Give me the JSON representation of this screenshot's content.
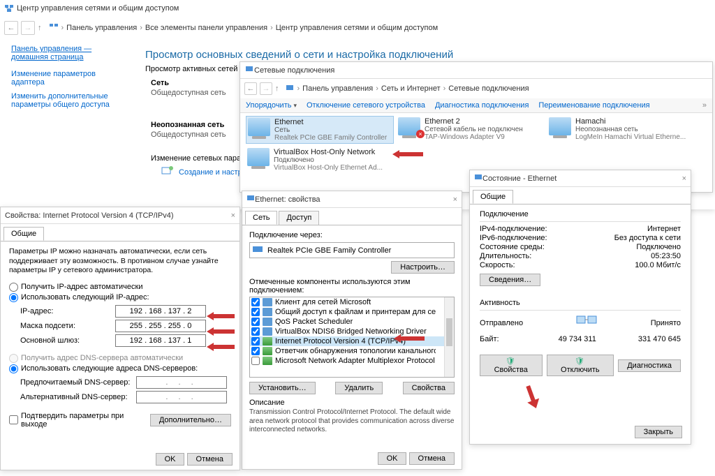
{
  "main": {
    "title": "Центр управления сетями и общим доступом",
    "breadcrumb": [
      "Панель управления",
      "Все элементы панели управления",
      "Центр управления сетями и общим доступом"
    ],
    "heading": "Просмотр основных сведений о сети и настройка подключений",
    "activeNetworks": "Просмотр активных сетей",
    "sidebar": {
      "home": "Панель управления — домашняя страница",
      "adapter": "Изменение параметров адаптера",
      "sharing": "Изменить дополнительные параметры общего доступа"
    },
    "net1": {
      "name": "Сеть",
      "type": "Общедоступная сеть"
    },
    "net2": {
      "name": "Неопознанная сеть",
      "type": "Общедоступная сеть"
    },
    "changeSettings": "Изменение сетевых параметров",
    "newConn": "Создание и настройка"
  },
  "netconn": {
    "title": "Сетевые подключения",
    "breadcrumb": [
      "Панель управления",
      "Сеть и Интернет",
      "Сетевые подключения"
    ],
    "toolbar": {
      "organize": "Упорядочить",
      "disable": "Отключение сетевого устройства",
      "diag": "Диагностика подключения",
      "rename": "Переименование подключения"
    },
    "conns": [
      {
        "name": "Ethernet",
        "l2": "Сеть",
        "l3": "Realtek PCIe GBE Family Controller"
      },
      {
        "name": "Ethernet 2",
        "l2": "Сетевой кабель не подключен",
        "l3": "TAP-Windows Adapter V9"
      },
      {
        "name": "Hamachi",
        "l2": "Неопознанная сеть",
        "l3": "LogMeIn Hamachi Virtual Etherne..."
      },
      {
        "name": "VirtualBox Host-Only Network",
        "l2": "Подключено",
        "l3": "VirtualBox Host-Only Ethernet Ad..."
      }
    ]
  },
  "ethprops": {
    "title": "Ethernet: свойства",
    "tabs": {
      "net": "Сеть",
      "access": "Доступ"
    },
    "connectVia": "Подключение через:",
    "adapter": "Realtek PCIe GBE Family Controller",
    "configure": "Настроить…",
    "componentsHeading": "Отмеченные компоненты используются этим подключением:",
    "components": [
      "Клиент для сетей Microsoft",
      "Общий доступ к файлам и принтерам для сетей Microsoft",
      "QoS Packet Scheduler",
      "VirtualBox NDIS6 Bridged Networking Driver",
      "Internet Protocol Version 4 (TCP/IPv4)",
      "Ответчик обнаружения топологии канального уровня",
      "Microsoft Network Adapter Multiplexor Protocol"
    ],
    "install": "Установить…",
    "remove": "Удалить",
    "props": "Свойства",
    "descHeading": "Описание",
    "desc": "Transmission Control Protocol/Internet Protocol. The default wide area network protocol that provides communication across diverse interconnected networks.",
    "ok": "OK",
    "cancel": "Отмена"
  },
  "status": {
    "title": "Состояние - Ethernet",
    "tab": "Общие",
    "connHeading": "Подключение",
    "rows": {
      "ipv4": {
        "k": "IPv4-подключение:",
        "v": "Интернет"
      },
      "ipv6": {
        "k": "IPv6-подключение:",
        "v": "Без доступа к сети"
      },
      "media": {
        "k": "Состояние среды:",
        "v": "Подключено"
      },
      "dur": {
        "k": "Длительность:",
        "v": "05:23:50"
      },
      "speed": {
        "k": "Скорость:",
        "v": "100.0 Мбит/с"
      }
    },
    "details": "Сведения…",
    "activity": "Активность",
    "sent": "Отправлено",
    "recv": "Принято",
    "bytesLabel": "Байт:",
    "bytesSent": "49 734 311",
    "bytesRecv": "331 470 645",
    "props": "Свойства",
    "disable": "Отключить",
    "diag": "Диагностика",
    "close": "Закрыть"
  },
  "ipv4": {
    "title": "Свойства: Internet Protocol Version 4 (TCP/IPv4)",
    "tab": "Общие",
    "note": "Параметры IP можно назначать автоматически, если сеть поддерживает эту возможность. В противном случае узнайте параметры IP у сетевого администратора.",
    "autoIP": "Получить IP-адрес автоматически",
    "manualIP": "Использовать следующий IP-адрес:",
    "ip": {
      "k": "IP-адрес:",
      "v": "192 . 168 . 137 .   2"
    },
    "mask": {
      "k": "Маска подсети:",
      "v": "255 . 255 . 255 .   0"
    },
    "gw": {
      "k": "Основной шлюз:",
      "v": "192 . 168 . 137 .   1"
    },
    "autoDNS": "Получить адрес DNS-сервера автоматически",
    "manualDNS": "Использовать следующие адреса DNS-серверов:",
    "dns1": "Предпочитаемый DNS-сервер:",
    "dns2": "Альтернативный DNS-сервер:",
    "validate": "Подтвердить параметры при выходе",
    "advanced": "Дополнительно…",
    "ok": "OK",
    "cancel": "Отмена"
  }
}
